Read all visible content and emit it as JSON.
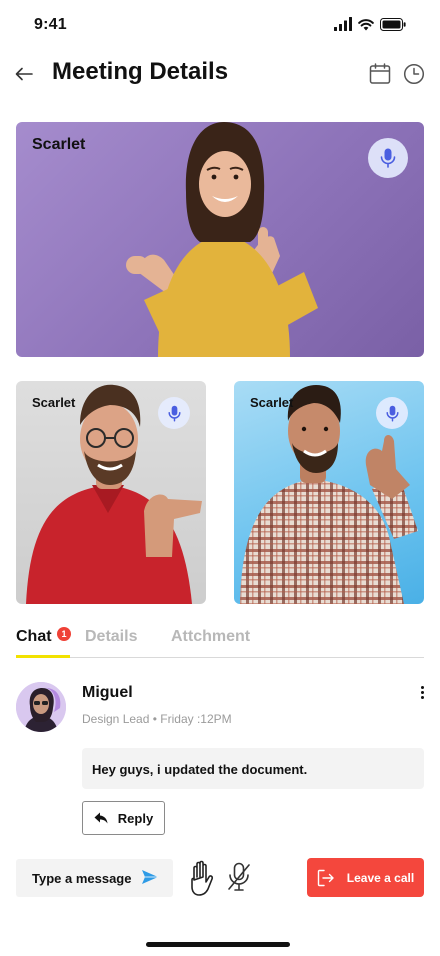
{
  "status_bar": {
    "time": "9:41"
  },
  "header": {
    "title": "Meeting Details"
  },
  "participants": [
    {
      "name": "Scarlet"
    },
    {
      "name": "Scarlet"
    },
    {
      "name": "Scarlet"
    }
  ],
  "tabs": [
    {
      "label": "Chat",
      "badge": "1",
      "active": true
    },
    {
      "label": "Details"
    },
    {
      "label": "Attchment"
    }
  ],
  "message": {
    "sender": "Miguel",
    "role": "Design Lead",
    "separator": "•",
    "time": "Friday :12PM",
    "text": "Hey guys, i updated the document.",
    "reply_label": "Reply"
  },
  "composer": {
    "placeholder": "Type a message"
  },
  "actions": {
    "leave_label": "Leave a call"
  },
  "colors": {
    "accent_underline": "#f2e200",
    "badge": "#ef4136",
    "leave_button": "#f4473d",
    "send_icon": "#2e9be6",
    "mic_icon": "#4a5ee0"
  }
}
